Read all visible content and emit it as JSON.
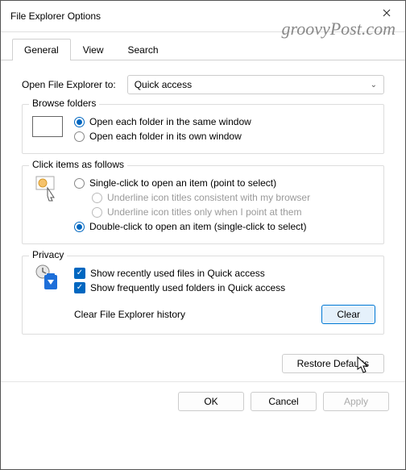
{
  "window": {
    "title": "File Explorer Options"
  },
  "watermark": "groovyPost.com",
  "tabs": {
    "general": "General",
    "view": "View",
    "search": "Search"
  },
  "open_to": {
    "label": "Open File Explorer to:",
    "value": "Quick access"
  },
  "browse": {
    "title": "Browse folders",
    "same": "Open each folder in the same window",
    "own": "Open each folder in its own window"
  },
  "click": {
    "title": "Click items as follows",
    "single": "Single-click to open an item (point to select)",
    "ul_browser": "Underline icon titles consistent with my browser",
    "ul_point": "Underline icon titles only when I point at them",
    "double": "Double-click to open an item (single-click to select)"
  },
  "privacy": {
    "title": "Privacy",
    "recent_files": "Show recently used files in Quick access",
    "freq_folders": "Show frequently used folders in Quick access",
    "clear_label": "Clear File Explorer history",
    "clear_btn": "Clear"
  },
  "restore": "Restore Defaults",
  "footer": {
    "ok": "OK",
    "cancel": "Cancel",
    "apply": "Apply"
  }
}
